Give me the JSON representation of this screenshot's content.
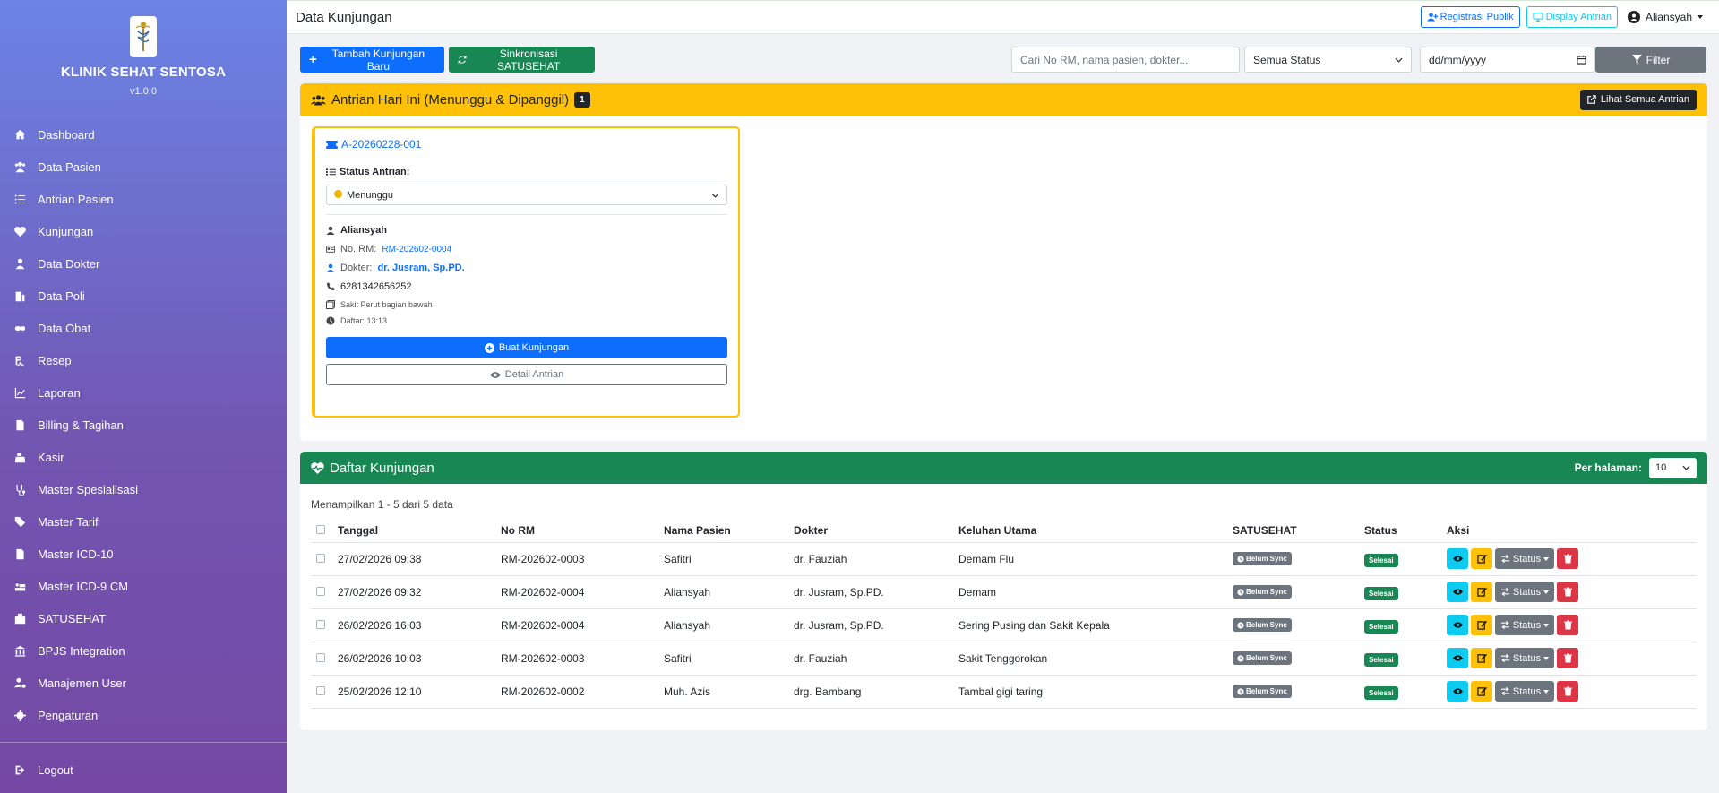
{
  "app": {
    "clinic_name": "KLINIK SEHAT SENTOSA",
    "version": "v1.0.0"
  },
  "sidebar": {
    "items": [
      {
        "label": "Dashboard",
        "icon": "home-icon"
      },
      {
        "label": "Data Pasien",
        "icon": "users-icon"
      },
      {
        "label": "Antrian Pasien",
        "icon": "list-ol-icon"
      },
      {
        "label": "Kunjungan",
        "icon": "heartbeat-icon"
      },
      {
        "label": "Data Dokter",
        "icon": "user-doctor-icon"
      },
      {
        "label": "Data Poli",
        "icon": "building-icon"
      },
      {
        "label": "Data Obat",
        "icon": "pills-icon"
      },
      {
        "label": "Resep",
        "icon": "prescription-icon"
      },
      {
        "label": "Laporan",
        "icon": "chart-line-icon"
      },
      {
        "label": "Billing & Tagihan",
        "icon": "file-invoice-icon"
      },
      {
        "label": "Kasir",
        "icon": "cash-register-icon"
      },
      {
        "label": "Master Spesialisasi",
        "icon": "stethoscope-icon"
      },
      {
        "label": "Master Tarif",
        "icon": "tags-icon"
      },
      {
        "label": "Master ICD-10",
        "icon": "file-medical-icon"
      },
      {
        "label": "Master ICD-9 CM",
        "icon": "procedures-icon"
      },
      {
        "label": "SATUSEHAT",
        "icon": "hospital-icon"
      },
      {
        "label": "BPJS Integration",
        "icon": "building-columns-icon"
      },
      {
        "label": "Manajemen User",
        "icon": "users-cog-icon"
      },
      {
        "label": "Pengaturan",
        "icon": "gear-icon"
      }
    ],
    "logout_label": "Logout"
  },
  "topbar": {
    "title": "Data Kunjungan",
    "registrasi_publik": "Registrasi Publik",
    "display_antrian": "Display Antrian",
    "user_name": "Aliansyah"
  },
  "actions": {
    "add_visit": "Tambah Kunjungan Baru",
    "sync": "Sinkronisasi SATUSEHAT",
    "search_placeholder": "Cari No RM, nama pasien, dokter...",
    "status_filter": "Semua Status",
    "date_placeholder": "dd/mm/yyyy",
    "filter": "Filter"
  },
  "queue_panel": {
    "title": "Antrian Hari Ini (Menunggu & Dipanggil)",
    "count": "1",
    "view_all": "Lihat Semua Antrian",
    "card": {
      "code": "A-20260228-001",
      "status_label": "Status Antrian:",
      "status_value": "Menunggu",
      "patient_name": "Aliansyah",
      "rm_label": "No. RM:",
      "rm_value": "RM-202602-0004",
      "doctor_label": "Dokter:",
      "doctor_value": "dr. Jusram, Sp.PD.",
      "phone": "6281342656252",
      "complaint": "Sakit Perut bagian bawah",
      "registered": "Daftar: 13:13",
      "create_visit": "Buat Kunjungan",
      "detail": "Detail Antrian"
    }
  },
  "visits": {
    "title": "Daftar Kunjungan",
    "per_page_label": "Per halaman:",
    "per_page_value": "10",
    "info": "Menampilkan 1 - 5 dari 5 data",
    "columns": [
      "Tanggal",
      "No RM",
      "Nama Pasien",
      "Dokter",
      "Keluhan Utama",
      "SATUSEHAT",
      "Status",
      "Aksi"
    ],
    "status_btn_label": "Status",
    "rows": [
      {
        "date": "27/02/2026 09:38",
        "rm": "RM-202602-0003",
        "name": "Safitri",
        "doctor": "dr. Fauziah",
        "complaint": "Demam Flu",
        "satusehat": "Belum Sync",
        "status": "Selesai"
      },
      {
        "date": "27/02/2026 09:32",
        "rm": "RM-202602-0004",
        "name": "Aliansyah",
        "doctor": "dr. Jusram, Sp.PD.",
        "complaint": "Demam",
        "satusehat": "Belum Sync",
        "status": "Selesai"
      },
      {
        "date": "26/02/2026 16:03",
        "rm": "RM-202602-0004",
        "name": "Aliansyah",
        "doctor": "dr. Jusram, Sp.PD.",
        "complaint": "Sering Pusing dan Sakit Kepala",
        "satusehat": "Belum Sync",
        "status": "Selesai"
      },
      {
        "date": "26/02/2026 10:03",
        "rm": "RM-202602-0003",
        "name": "Safitri",
        "doctor": "dr. Fauziah",
        "complaint": "Sakit Tenggorokan",
        "satusehat": "Belum Sync",
        "status": "Selesai"
      },
      {
        "date": "25/02/2026 12:10",
        "rm": "RM-202602-0002",
        "name": "Muh. Azis",
        "doctor": "drg. Bambang",
        "complaint": "Tambal gigi taring",
        "satusehat": "Belum Sync",
        "status": "Selesai"
      }
    ]
  },
  "colors": {
    "primary": "#0d6efd",
    "success": "#198754",
    "warning": "#ffc107",
    "danger": "#dc3545",
    "info": "#0dcaf0",
    "secondary": "#6c757d"
  }
}
